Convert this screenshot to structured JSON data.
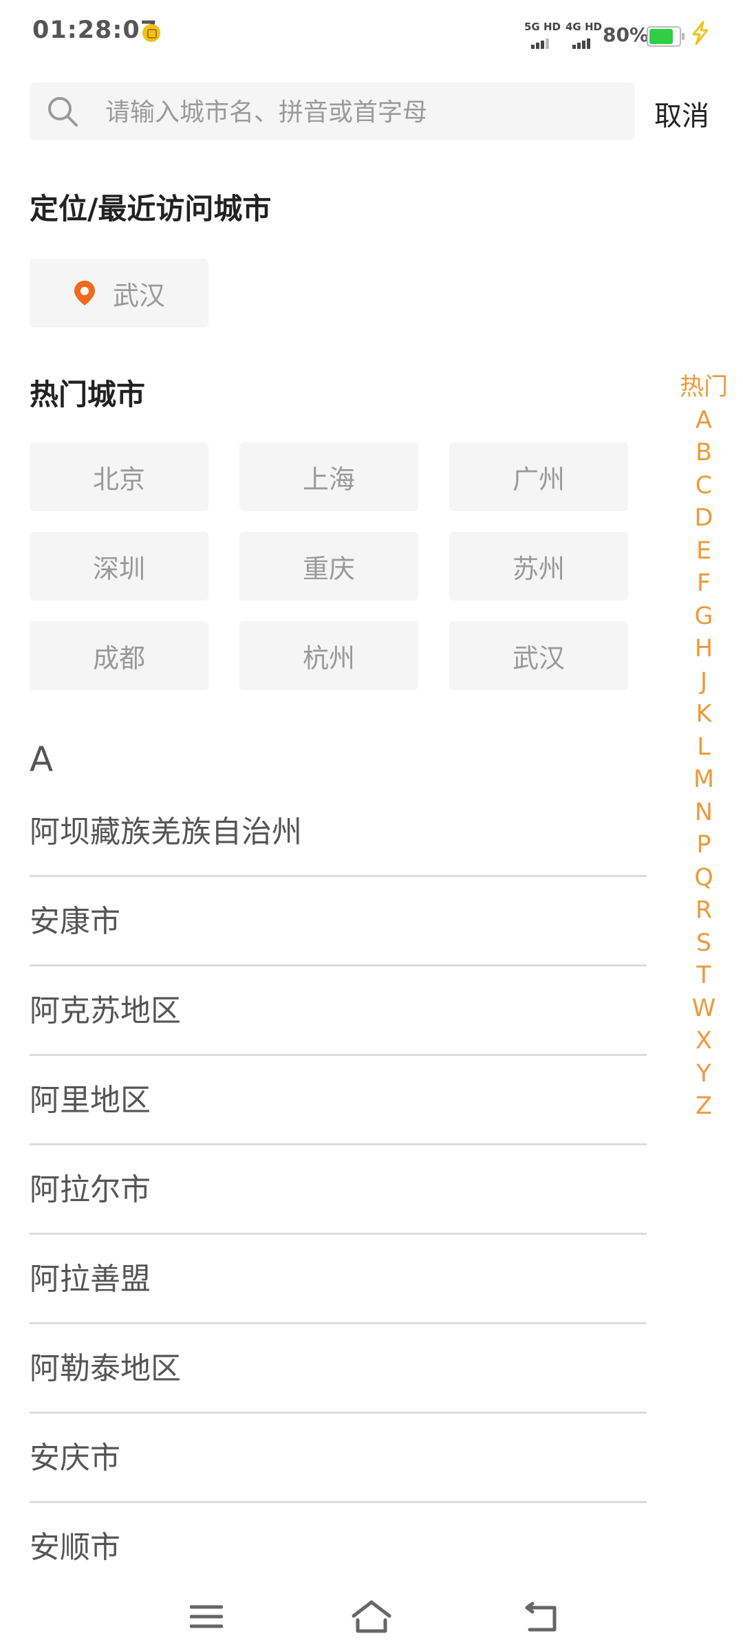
{
  "status_bar": {
    "time": "01:28:07",
    "network_1": "5G HD",
    "network_2": "4G HD",
    "battery_percent": "80%",
    "battery_level": 0.8,
    "battery_color": "#2fce45"
  },
  "search": {
    "placeholder": "请输入城市名、拼音或首字母",
    "value": "",
    "cancel_label": "取消"
  },
  "location_section": {
    "title": "定位/最近访问城市",
    "current_city": "武汉"
  },
  "hot_section": {
    "title": "热门城市",
    "cities": [
      "北京",
      "上海",
      "广州",
      "深圳",
      "重庆",
      "苏州",
      "成都",
      "杭州",
      "武汉"
    ]
  },
  "city_list": {
    "letter": "A",
    "cities": [
      "阿坝藏族羌族自治州",
      "安康市",
      "阿克苏地区",
      "阿里地区",
      "阿拉尔市",
      "阿拉善盟",
      "阿勒泰地区",
      "安庆市",
      "安顺市"
    ]
  },
  "index_bar": {
    "items": [
      "热门",
      "A",
      "B",
      "C",
      "D",
      "E",
      "F",
      "G",
      "H",
      "J",
      "K",
      "L",
      "M",
      "N",
      "P",
      "Q",
      "R",
      "S",
      "T",
      "W",
      "X",
      "Y",
      "Z"
    ],
    "color": "#ee9a3a"
  },
  "accent_color": "#f26a1b"
}
